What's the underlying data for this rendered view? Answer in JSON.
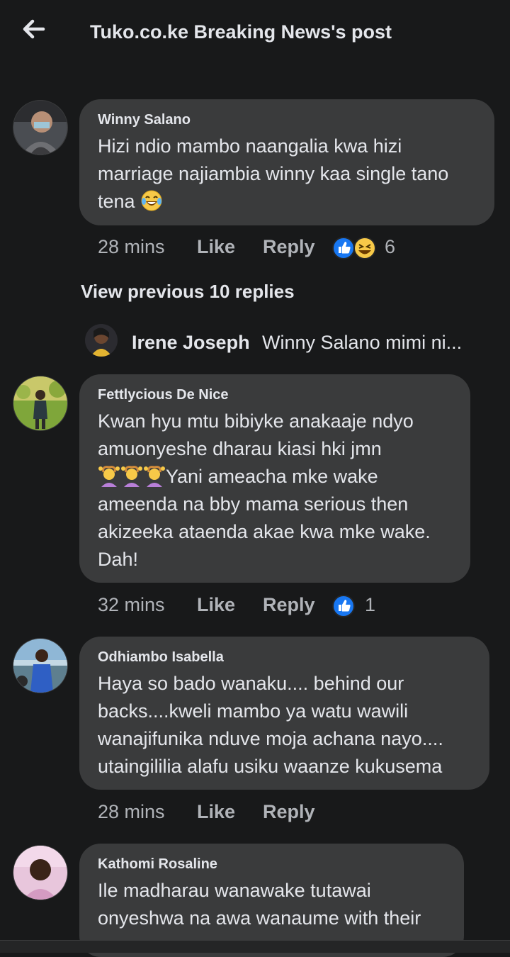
{
  "header": {
    "title": "Tuko.co.ke Breaking News's post",
    "back_icon": "arrow-left-icon"
  },
  "comments": [
    {
      "name": "Winny Salano",
      "lines": [
        "Hizi ndio mambo naangalia kwa hizi",
        "marriage najiambia winny kaa single tano",
        "tena"
      ],
      "time": "28 mins",
      "like": "Like",
      "reply": "Reply",
      "reactions": [
        "like-icon",
        "laugh-icon"
      ],
      "reaction_count": "6"
    },
    {
      "name": "Fettlycious De Nice",
      "lines": [
        "Kwan hyu mtu bibiyke anakaaje ndyo",
        "amuonyeshe dharau kiasi hki jmn",
        "Yani ameacha mke wake",
        "ameenda na bby mama serious then",
        "akizeeka ataenda akae kwa mke wake.",
        "Dah!"
      ],
      "time": "32 mins",
      "like": "Like",
      "reply": "Reply",
      "reactions": [
        "like-icon"
      ],
      "reaction_count": "1"
    },
    {
      "name": "Odhiambo Isabella",
      "lines": [
        "Haya so bado wanaku.... behind our",
        "backs....kweli mambo ya watu wawili",
        "wanajifunika nduve moja achana nayo....",
        "utaingililia alafu usiku waanze kukusema"
      ],
      "time": "28 mins",
      "like": "Like",
      "reply": "Reply"
    },
    {
      "name": "Kathomi Rosaline",
      "lines": [
        "Ile madharau wanawake tutawai",
        "onyeshwa na awa wanaume with their"
      ]
    }
  ],
  "view_previous": "View previous 10 replies",
  "reply_preview": {
    "name": "Irene Joseph",
    "text": "Winny Salano mimi ni..."
  },
  "colors": {
    "background": "#18191a",
    "bubble": "#3a3b3c",
    "text": "#e4e6eb",
    "muted": "#b0b3b8",
    "like_blue": "#1877f2"
  }
}
